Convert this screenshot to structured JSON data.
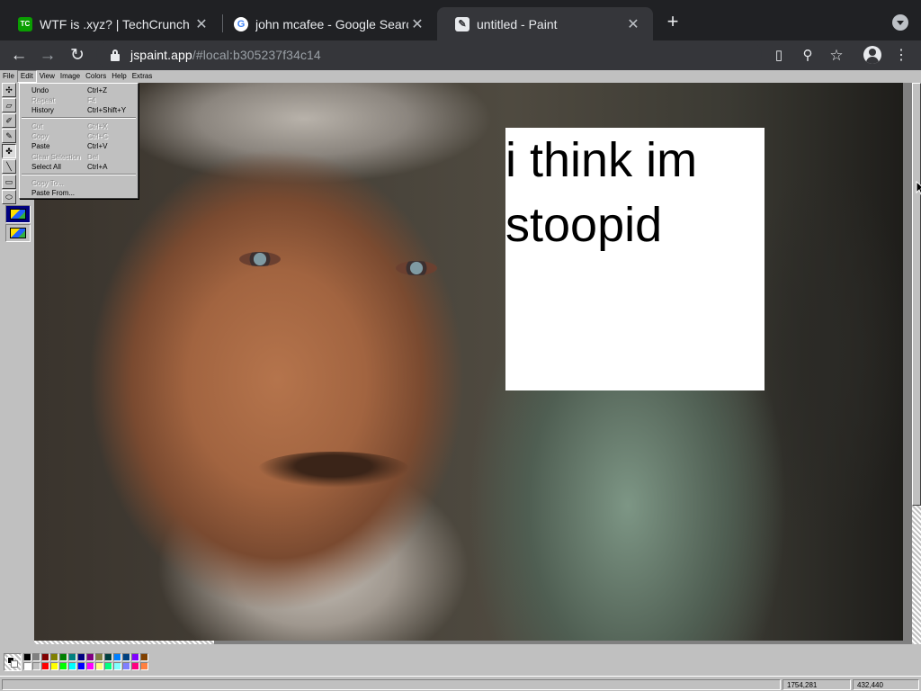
{
  "browser": {
    "tabs": [
      {
        "title": "WTF is .xyz? | TechCrunch",
        "favicon_text": "TC",
        "favicon_color": "#0a9e01"
      },
      {
        "title": "john mcafee - Google Search",
        "favicon_text": "G",
        "favicon_color": "#ffffff"
      },
      {
        "title": "untitled - Paint",
        "favicon_text": "🖌",
        "favicon_color": "#35363a",
        "active": true
      }
    ],
    "url_host": "jspaint.app",
    "url_path": "/#local:b305237f34c14"
  },
  "paint": {
    "menus": [
      "File",
      "Edit",
      "View",
      "Image",
      "Colors",
      "Help",
      "Extras"
    ],
    "open_menu": "Edit",
    "edit_menu": [
      {
        "label": "Undo",
        "shortcut": "Ctrl+Z",
        "enabled": true
      },
      {
        "label": "Repeat",
        "shortcut": "F4",
        "enabled": false
      },
      {
        "label": "History",
        "shortcut": "Ctrl+Shift+Y",
        "enabled": true
      },
      {
        "label": "Cut",
        "shortcut": "Ctrl+X",
        "enabled": false
      },
      {
        "label": "Copy",
        "shortcut": "Ctrl+C",
        "enabled": false
      },
      {
        "label": "Paste",
        "shortcut": "Ctrl+V",
        "enabled": true
      },
      {
        "label": "Clear Selection",
        "shortcut": "Del",
        "enabled": false
      },
      {
        "label": "Select All",
        "shortcut": "Ctrl+A",
        "enabled": true
      },
      {
        "label": "Copy To...",
        "shortcut": "",
        "enabled": false
      },
      {
        "label": "Paste From...",
        "shortcut": "",
        "enabled": true
      }
    ],
    "canvas_text": "i think im\nstoopid",
    "palette": [
      "#000000",
      "#808080",
      "#800000",
      "#808000",
      "#008000",
      "#008080",
      "#000080",
      "#800080",
      "#808040",
      "#004040",
      "#0080ff",
      "#004080",
      "#8000ff",
      "#804000",
      "#ffffff",
      "#c0c0c0",
      "#ff0000",
      "#ffff00",
      "#00ff00",
      "#00ffff",
      "#0000ff",
      "#ff00ff",
      "#ffff80",
      "#00ff80",
      "#80ffff",
      "#8080ff",
      "#ff0080",
      "#ff8040"
    ],
    "status_left": "",
    "status_pos": "1754,281",
    "status_size": "432,440"
  }
}
